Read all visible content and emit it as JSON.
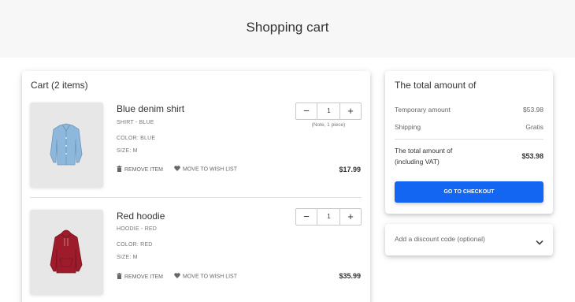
{
  "header": {
    "title": "Shopping cart"
  },
  "cart": {
    "heading": "Cart (2 items)",
    "items": [
      {
        "name": "Blue denim shirt",
        "subtitle": "SHIRT - BLUE",
        "color": "COLOR: BLUE",
        "size": "SIZE: M",
        "quantity": "1",
        "qty_minus": "−",
        "qty_plus": "+",
        "note": "(Note, 1 piece)",
        "remove_label": "REMOVE ITEM",
        "wishlist_label": "MOVE TO WISH LIST",
        "price": "$17.99",
        "image_icon": "shirt-image",
        "image_color": "#8db8dc"
      },
      {
        "name": "Red hoodie",
        "subtitle": "HOODIE - RED",
        "color": "COLOR: RED",
        "size": "SIZE: M",
        "quantity": "1",
        "qty_minus": "−",
        "qty_plus": "+",
        "remove_label": "REMOVE ITEM",
        "wishlist_label": "MOVE TO WISH LIST",
        "price": "$35.99",
        "image_icon": "hoodie-image",
        "image_color": "#9e1b2c"
      }
    ]
  },
  "summary": {
    "title": "The total amount of",
    "rows": [
      {
        "label": "Temporary amount",
        "value": "$53.98"
      },
      {
        "label": "Shipping",
        "value": "Gratis"
      }
    ],
    "total_label_line1": "The total amount of",
    "total_label_line2": "(including VAT)",
    "total_value": "$53.98",
    "checkout_label": "GO TO CHECKOUT"
  },
  "discount": {
    "label": "Add a discount code (optional)"
  },
  "colors": {
    "accent": "#1266f1",
    "header_bg": "#f7f7f7"
  }
}
